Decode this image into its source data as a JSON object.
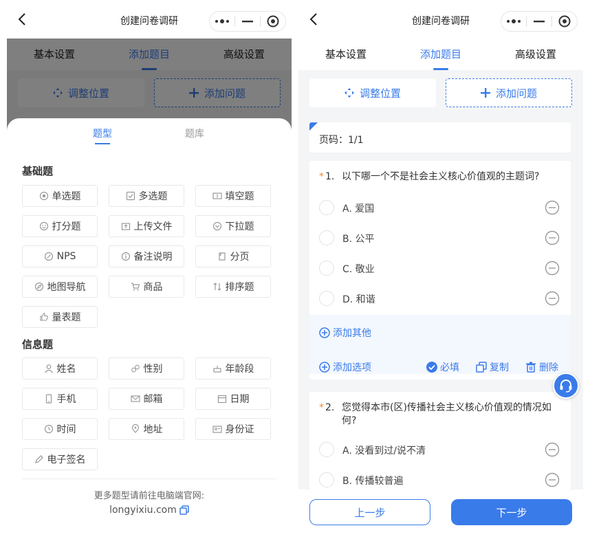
{
  "navbar": {
    "title": "创建问卷调研"
  },
  "tabs": [
    "基本设置",
    "添加题目",
    "高级设置"
  ],
  "actions": {
    "adjust": "调整位置",
    "add": "添加问题"
  },
  "sheet": {
    "tabs": [
      "题型",
      "题库"
    ],
    "basic_title": "基础题",
    "basic": [
      {
        "label": "单选题",
        "icon": "radio-icon"
      },
      {
        "label": "多选题",
        "icon": "checkbox-icon"
      },
      {
        "label": "填空题",
        "icon": "text-input-icon"
      },
      {
        "label": "打分题",
        "icon": "smiley-icon"
      },
      {
        "label": "上传文件",
        "icon": "upload-icon"
      },
      {
        "label": "下拉题",
        "icon": "dropdown-icon"
      },
      {
        "label": "NPS",
        "icon": "nps-icon"
      },
      {
        "label": "备注说明",
        "icon": "info-icon"
      },
      {
        "label": "分页",
        "icon": "page-icon"
      },
      {
        "label": "地图导航",
        "icon": "compass-icon"
      },
      {
        "label": "商品",
        "icon": "cart-icon"
      },
      {
        "label": "排序题",
        "icon": "sort-icon"
      },
      {
        "label": "量表题",
        "icon": "thumb-icon"
      }
    ],
    "info_title": "信息题",
    "info": [
      {
        "label": "姓名",
        "icon": "person-icon"
      },
      {
        "label": "性别",
        "icon": "gender-icon"
      },
      {
        "label": "年龄段",
        "icon": "cake-icon"
      },
      {
        "label": "手机",
        "icon": "phone-icon"
      },
      {
        "label": "邮箱",
        "icon": "mail-icon"
      },
      {
        "label": "日期",
        "icon": "calendar-icon"
      },
      {
        "label": "时间",
        "icon": "clock-icon"
      },
      {
        "label": "地址",
        "icon": "location-icon"
      },
      {
        "label": "身份证",
        "icon": "id-card-icon"
      },
      {
        "label": "电子签名",
        "icon": "pen-icon"
      }
    ],
    "footer_line1": "更多题型请前往电脑端官网:",
    "footer_line2": "longyixiu.com"
  },
  "page_label": "页码：1/1",
  "questions": [
    {
      "star": "*",
      "num": "1.",
      "text": "以下哪一个不是社会主义核心价值观的主题词?",
      "options": [
        "A. 爱国",
        "B. 公平",
        "C. 敬业",
        "D. 和谐"
      ],
      "add_other": "添加其他",
      "add_option": "添加选项",
      "required": "必填",
      "copy": "复制",
      "delete": "删除"
    },
    {
      "star": "*",
      "num": "2.",
      "text": "您觉得本市(区)传播社会主义核心价值观的情况如何?",
      "options": [
        "A. 没看到过/说不清",
        "B. 传播较普遍"
      ]
    }
  ],
  "bottom": {
    "prev": "上一步",
    "next": "下一步"
  },
  "colors": {
    "accent": "#3a7bea",
    "required_star": "#f08c2b"
  }
}
